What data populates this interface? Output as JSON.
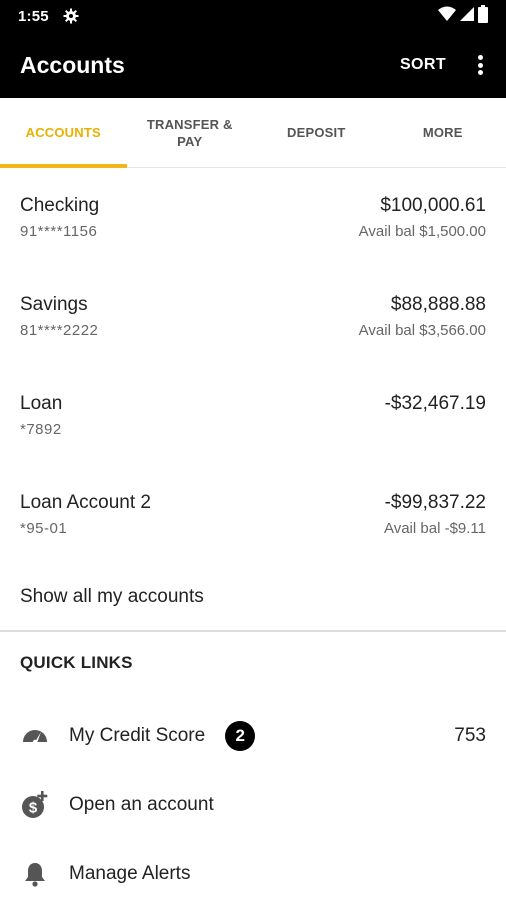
{
  "status_bar": {
    "time": "1:55",
    "icons": [
      "gear-icon",
      "wifi-icon",
      "cell-signal-icon",
      "battery-icon"
    ]
  },
  "app_bar": {
    "title": "Accounts",
    "sort_label": "SORT",
    "more_icon": "more-vert-icon"
  },
  "tabs": [
    {
      "label": "ACCOUNTS",
      "active": true
    },
    {
      "label": "TRANSFER & PAY",
      "active": false
    },
    {
      "label": "DEPOSIT",
      "active": false
    },
    {
      "label": "MORE",
      "active": false
    }
  ],
  "accounts": [
    {
      "name": "Checking",
      "number": "91****1156",
      "balance": "$100,000.61",
      "avail": "Avail bal $1,500.00"
    },
    {
      "name": "Savings",
      "number": "81****2222",
      "balance": "$88,888.88",
      "avail": "Avail bal $3,566.00"
    },
    {
      "name": "Loan",
      "number": "*7892",
      "balance": "-$32,467.19",
      "avail": ""
    },
    {
      "name": "Loan Account 2",
      "number": "*95-01",
      "balance": "-$99,837.22",
      "avail": "Avail bal -$9.11"
    }
  ],
  "show_all_label": "Show all my accounts",
  "quick_links": {
    "header": "QUICK LINKS",
    "items": [
      {
        "icon": "speedometer-icon",
        "label": "My Credit Score",
        "badge": "2",
        "value": "753"
      },
      {
        "icon": "dollar-add-icon",
        "label": "Open an account"
      },
      {
        "icon": "bell-icon",
        "label": "Manage Alerts"
      }
    ]
  },
  "colors": {
    "header_bg": "#000000",
    "accent": "#f2b51c",
    "active_tab_text": "#e8b000"
  }
}
